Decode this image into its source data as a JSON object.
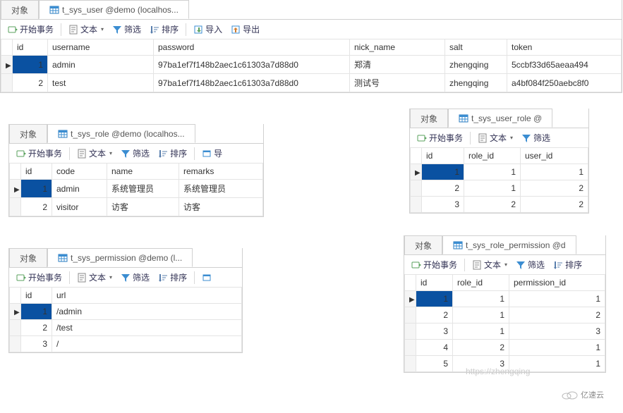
{
  "labels": {
    "objects_tab": "对象",
    "begin_tx": "开始事务",
    "text": "文本",
    "filter": "筛选",
    "sort": "排序",
    "import": "导入",
    "export": "导出",
    "import_short": "导"
  },
  "user_panel": {
    "tab_title": "t_sys_user @demo (localhos...",
    "columns": {
      "id": "id",
      "username": "username",
      "password": "password",
      "nick_name": "nick_name",
      "salt": "salt",
      "token": "token"
    },
    "rows": [
      {
        "id": "1",
        "username": "admin",
        "password": "97ba1ef7f148b2aec1c61303a7d88d0",
        "nick_name": "郑清",
        "salt": "zhengqing",
        "token": "5ccbf33d65aeaa494"
      },
      {
        "id": "2",
        "username": "test",
        "password": "97ba1ef7f148b2aec1c61303a7d88d0",
        "nick_name": "测试号",
        "salt": "zhengqing",
        "token": "a4bf084f250aebc8f0"
      }
    ]
  },
  "role_panel": {
    "tab_title": "t_sys_role @demo (localhos...",
    "columns": {
      "id": "id",
      "code": "code",
      "name": "name",
      "remarks": "remarks"
    },
    "rows": [
      {
        "id": "1",
        "code": "admin",
        "name": "系统管理员",
        "remarks": "系统管理员"
      },
      {
        "id": "2",
        "code": "visitor",
        "name": "访客",
        "remarks": "访客"
      }
    ]
  },
  "user_role_panel": {
    "tab_title": "t_sys_user_role @",
    "columns": {
      "id": "id",
      "role_id": "role_id",
      "user_id": "user_id"
    },
    "rows": [
      {
        "id": "1",
        "role_id": "1",
        "user_id": "1"
      },
      {
        "id": "2",
        "role_id": "1",
        "user_id": "2"
      },
      {
        "id": "3",
        "role_id": "2",
        "user_id": "2"
      }
    ]
  },
  "permission_panel": {
    "tab_title": "t_sys_permission @demo (l...",
    "columns": {
      "id": "id",
      "url": "url"
    },
    "rows": [
      {
        "id": "1",
        "url": "/admin"
      },
      {
        "id": "2",
        "url": "/test"
      },
      {
        "id": "3",
        "url": "/"
      }
    ]
  },
  "role_permission_panel": {
    "tab_title": "t_sys_role_permission @d",
    "columns": {
      "id": "id",
      "role_id": "role_id",
      "permission_id": "permission_id"
    },
    "rows": [
      {
        "id": "1",
        "role_id": "1",
        "permission_id": "1"
      },
      {
        "id": "2",
        "role_id": "1",
        "permission_id": "2"
      },
      {
        "id": "3",
        "role_id": "1",
        "permission_id": "3"
      },
      {
        "id": "4",
        "role_id": "2",
        "permission_id": "1"
      },
      {
        "id": "5",
        "role_id": "3",
        "permission_id": "1"
      }
    ]
  },
  "watermark": "https://zhengqing",
  "logo_text": "亿速云"
}
